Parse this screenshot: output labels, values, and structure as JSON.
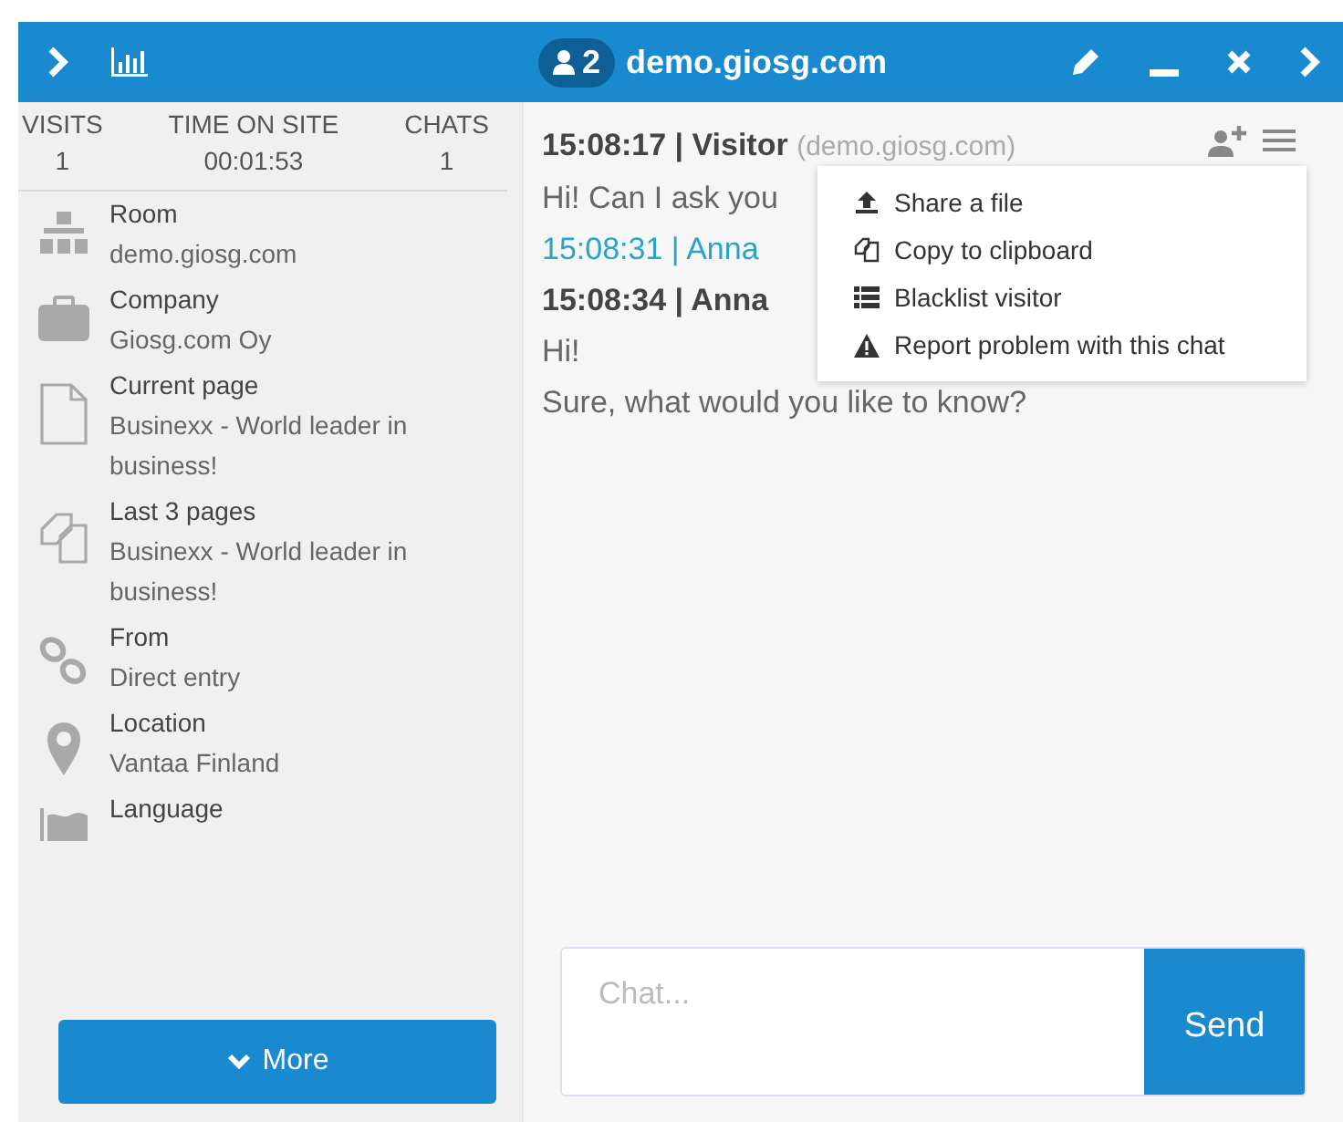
{
  "header": {
    "visitor_count": "2",
    "title": "demo.giosg.com"
  },
  "stats": [
    {
      "label": "VISITS",
      "value": "1"
    },
    {
      "label": "TIME ON SITE",
      "value": "00:01:53"
    },
    {
      "label": "CHATS",
      "value": "1"
    }
  ],
  "info": [
    {
      "kind": "room",
      "label": "Room",
      "value": "demo.giosg.com"
    },
    {
      "kind": "company",
      "label": "Company",
      "value": "Giosg.com Oy"
    },
    {
      "kind": "page",
      "label": "Current page",
      "value": "Businexx - World leader in business!"
    },
    {
      "kind": "pages",
      "label": "Last 3 pages",
      "value": "Businexx - World leader in business!"
    },
    {
      "kind": "link",
      "label": "From",
      "value": "Direct entry"
    },
    {
      "kind": "location",
      "label": "Location",
      "value": "Vantaa Finland"
    },
    {
      "kind": "language",
      "label": "Language"
    }
  ],
  "more_button": "More",
  "messages": [
    {
      "kind": "header",
      "time": "15:08:17 | Visitor",
      "host": "(demo.giosg.com)"
    },
    {
      "kind": "text",
      "text": "Hi! Can I ask you"
    },
    {
      "kind": "agent",
      "time": "15:08:31 | Anna"
    },
    {
      "kind": "header",
      "time": "15:08:34 | Anna"
    },
    {
      "kind": "text",
      "text": "Hi!"
    },
    {
      "kind": "text",
      "text": "Sure, what would you like to know?"
    }
  ],
  "menu": [
    {
      "kind": "upload",
      "label": "Share a file"
    },
    {
      "kind": "copy",
      "label": "Copy to clipboard"
    },
    {
      "kind": "list",
      "label": "Blacklist visitor"
    },
    {
      "kind": "warning",
      "label": "Report problem with this chat"
    }
  ],
  "composer": {
    "placeholder": "Chat...",
    "send": "Send"
  }
}
